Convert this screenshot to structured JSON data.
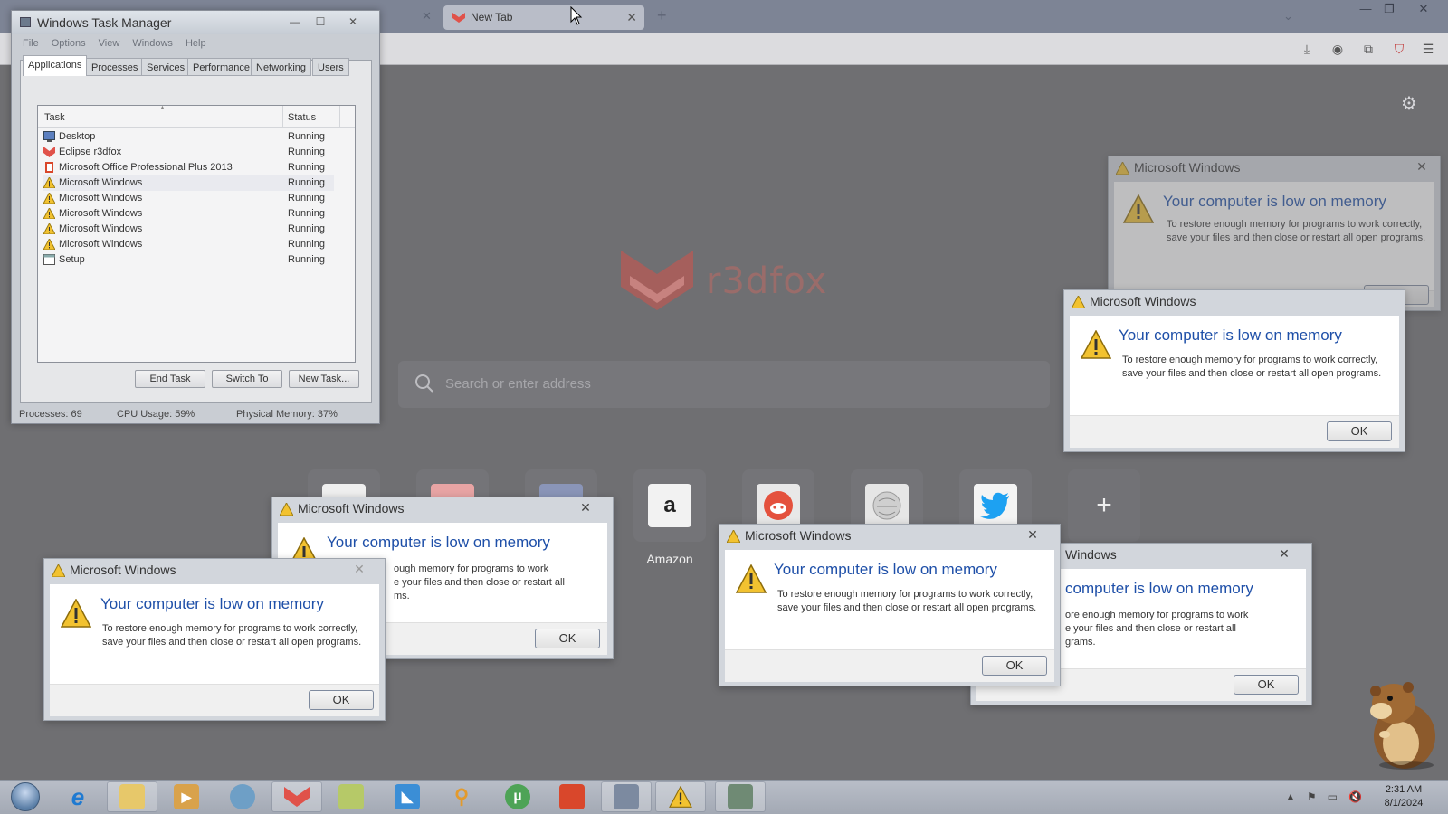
{
  "browser": {
    "tab_title": "New Tab",
    "search_placeholder": "Search or enter address",
    "logo_text": "r3dfox",
    "shortcuts": [
      {
        "name": "amazon",
        "label": "Amazon",
        "glyph": "a",
        "color": "#222222"
      },
      {
        "name": "reddit",
        "label": "",
        "glyph": "●",
        "color": "#ff4500"
      },
      {
        "name": "wikipedia",
        "label": "",
        "glyph": "W",
        "color": "#666666"
      },
      {
        "name": "twitter",
        "label": "",
        "glyph": "🐦",
        "color": "#1da1f2"
      }
    ],
    "add_glyph": "+"
  },
  "taskmgr": {
    "title": "Windows Task Manager",
    "menu": [
      "File",
      "Options",
      "View",
      "Windows",
      "Help"
    ],
    "tabs": [
      "Applications",
      "Processes",
      "Services",
      "Performance",
      "Networking",
      "Users"
    ],
    "col_task": "Task",
    "col_status": "Status",
    "rows": [
      {
        "name": "Desktop",
        "status": "Running",
        "icon": "desktop"
      },
      {
        "name": "Eclipse r3dfox",
        "status": "Running",
        "icon": "fox"
      },
      {
        "name": "Microsoft Office Professional Plus 2013",
        "status": "Running",
        "icon": "office"
      },
      {
        "name": "Microsoft Windows",
        "status": "Running",
        "icon": "warning"
      },
      {
        "name": "Microsoft Windows",
        "status": "Running",
        "icon": "warning"
      },
      {
        "name": "Microsoft Windows",
        "status": "Running",
        "icon": "warning"
      },
      {
        "name": "Microsoft Windows",
        "status": "Running",
        "icon": "warning"
      },
      {
        "name": "Microsoft Windows",
        "status": "Running",
        "icon": "warning"
      },
      {
        "name": "Setup",
        "status": "Running",
        "icon": "window"
      }
    ],
    "btn_end": "End Task",
    "btn_switch": "Switch To",
    "btn_new": "New Task...",
    "status_processes": "Processes: 69",
    "status_cpu": "CPU Usage: 59%",
    "status_mem": "Physical Memory: 37%"
  },
  "dialog": {
    "title": "Microsoft Windows",
    "title_partial": "Windows",
    "heading": "Your computer is low on memory",
    "heading_partial": "computer is low on memory",
    "body": "To restore enough memory for programs to work correctly, save your files and then close or restart all open programs.",
    "body_partial_a": "ough memory for programs to work",
    "body_partial_b": "e your files and then close or restart all",
    "body_partial_c": "ms.",
    "body_partial2_a": "ore enough memory for programs to work",
    "body_partial2_b": "e your files and then close or restart all",
    "body_partial2_c": "grams.",
    "ok": "OK"
  },
  "taskbar": {
    "time": "2:31 AM",
    "date": "8/1/2024"
  },
  "colors": {
    "accent_fox": "#e0524a",
    "dialog_heading": "#1e4fa8",
    "warning": "#f2c230"
  }
}
